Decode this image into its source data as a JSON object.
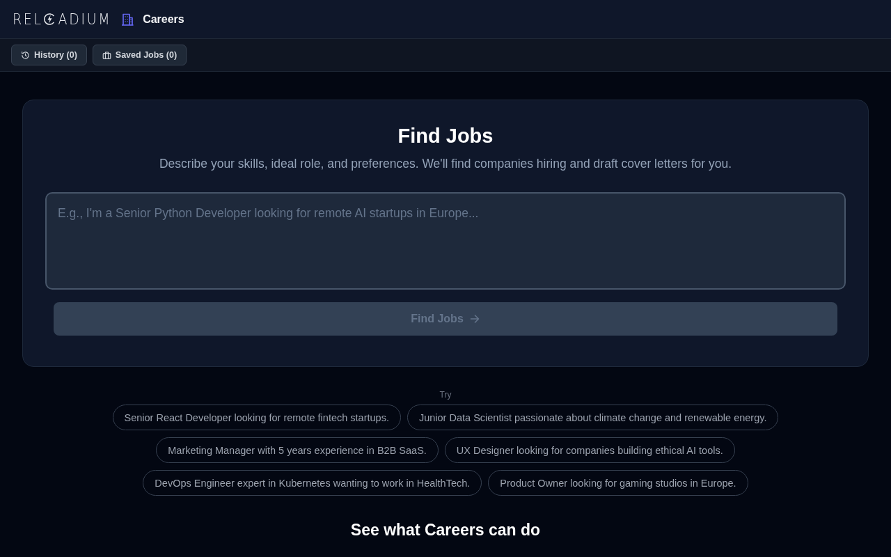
{
  "header": {
    "logo": {
      "text_before_mark": "REL",
      "text_after_mark": "ADIUM"
    },
    "app_name": "Careers"
  },
  "toolbar": {
    "buttons": [
      {
        "kind": "history",
        "label": "History (0)"
      },
      {
        "kind": "saved",
        "label": "Saved Jobs (0)"
      }
    ]
  },
  "search_card": {
    "title": "Find Jobs",
    "subtitle": "Describe your skills, ideal role, and preferences. We'll find companies hiring and draft cover letters for you.",
    "query": {
      "placeholder": "E.g., I'm a Senior Python Developer looking for remote AI startups in Europe..."
    },
    "submit": {
      "label": "Find Jobs",
      "disabled": true
    }
  },
  "suggestions": {
    "label": "Try",
    "items": [
      "Senior React Developer looking for remote fintech startups.",
      "Junior Data Scientist passionate about climate change and renewable energy.",
      "Marketing Manager with 5 years experience in B2B SaaS.",
      "UX Designer looking for companies building ethical AI tools.",
      "DevOps Engineer expert in Kubernetes wanting to work in HealthTech.",
      "Product Owner looking for gaming studios in Europe."
    ]
  },
  "features": {
    "title": "See what Careers can do"
  }
}
